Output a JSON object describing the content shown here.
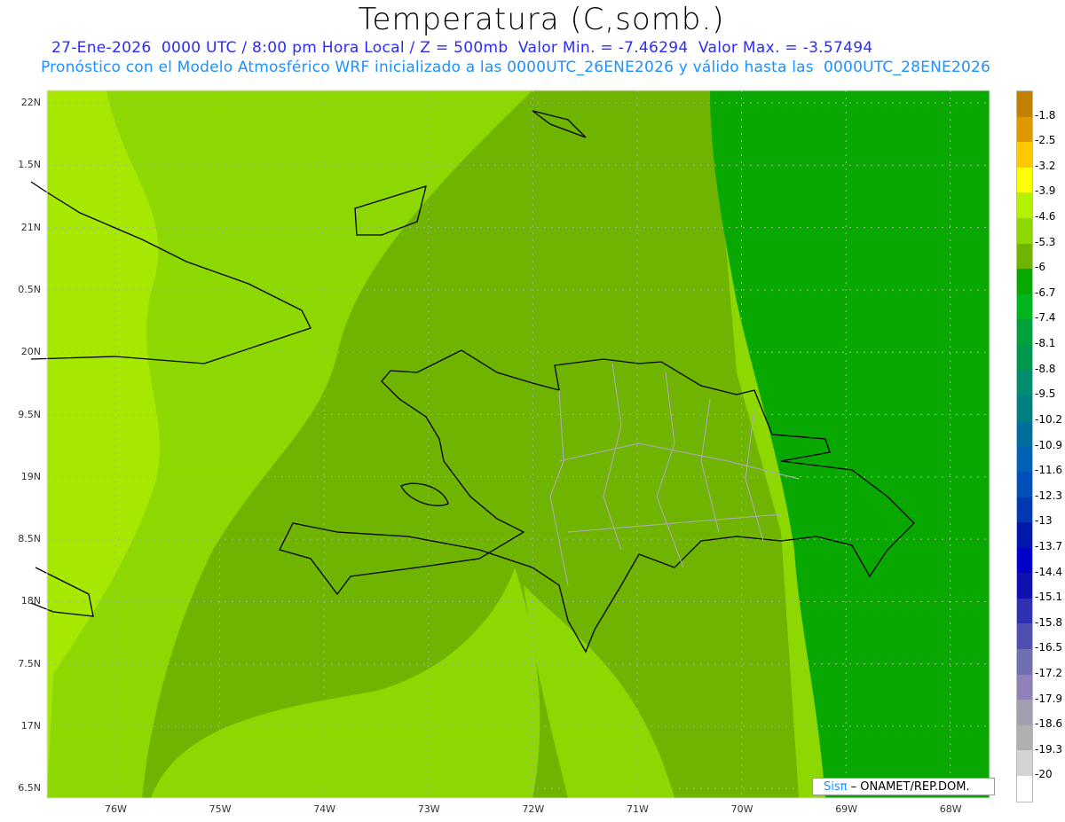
{
  "title": "Temperatura (C,somb.)",
  "subtitle1": "27-Ene-2026  0000 UTC / 8:00 pm Hora Local / Z = 500mb  Valor Min. = -7.46294  Valor Max. = -3.57494",
  "subtitle2": "Pronóstico con el Modelo Atmosférico WRF inicializado a las 0000UTC_26ENE2026 y válido hasta las  0000UTC_28ENE2026",
  "lat_labels": [
    "22N",
    "1.5N",
    "21N",
    "0.5N",
    "20N",
    "9.5N",
    "19N",
    "8.5N",
    "18N",
    "7.5N",
    "17N",
    "6.5N"
  ],
  "lon_labels": [
    "76W",
    "75W",
    "74W",
    "73W",
    "72W",
    "71W",
    "70W",
    "69W",
    "68W"
  ],
  "badge": {
    "brand": "Sisπ",
    "text": "– ONAMET/REP.DOM."
  },
  "colorbar": {
    "labels": [
      "-1.8",
      "-2.5",
      "-3.2",
      "-3.9",
      "-4.6",
      "-5.3",
      "-6",
      "-6.7",
      "-7.4",
      "-8.1",
      "-8.8",
      "-9.5",
      "-10.2",
      "-10.9",
      "-11.6",
      "-12.3",
      "-13",
      "-13.7",
      "-14.4",
      "-15.1",
      "-15.8",
      "-16.5",
      "-17.2",
      "-17.9",
      "-18.6",
      "-19.3",
      "-20"
    ],
    "colors": [
      "#c08000",
      "#e09800",
      "#ffc800",
      "#ffff00",
      "#b4f000",
      "#8cd800",
      "#6eb400",
      "#08a800",
      "#00b41e",
      "#00a03c",
      "#009650",
      "#008c6e",
      "#007f80",
      "#006e9a",
      "#0060b4",
      "#0050b8",
      "#0038b0",
      "#0018aa",
      "#0000c8",
      "#1010b0",
      "#3030b0",
      "#5050b0",
      "#7070b0",
      "#9080b8",
      "#a0a0b0",
      "#b0b0b0",
      "#d4d4d4",
      "#ffffff"
    ]
  },
  "field_colors": {
    "light": "#a6e800",
    "mid_light": "#8cd800",
    "mid": "#6eb400",
    "dark": "#08a800"
  }
}
